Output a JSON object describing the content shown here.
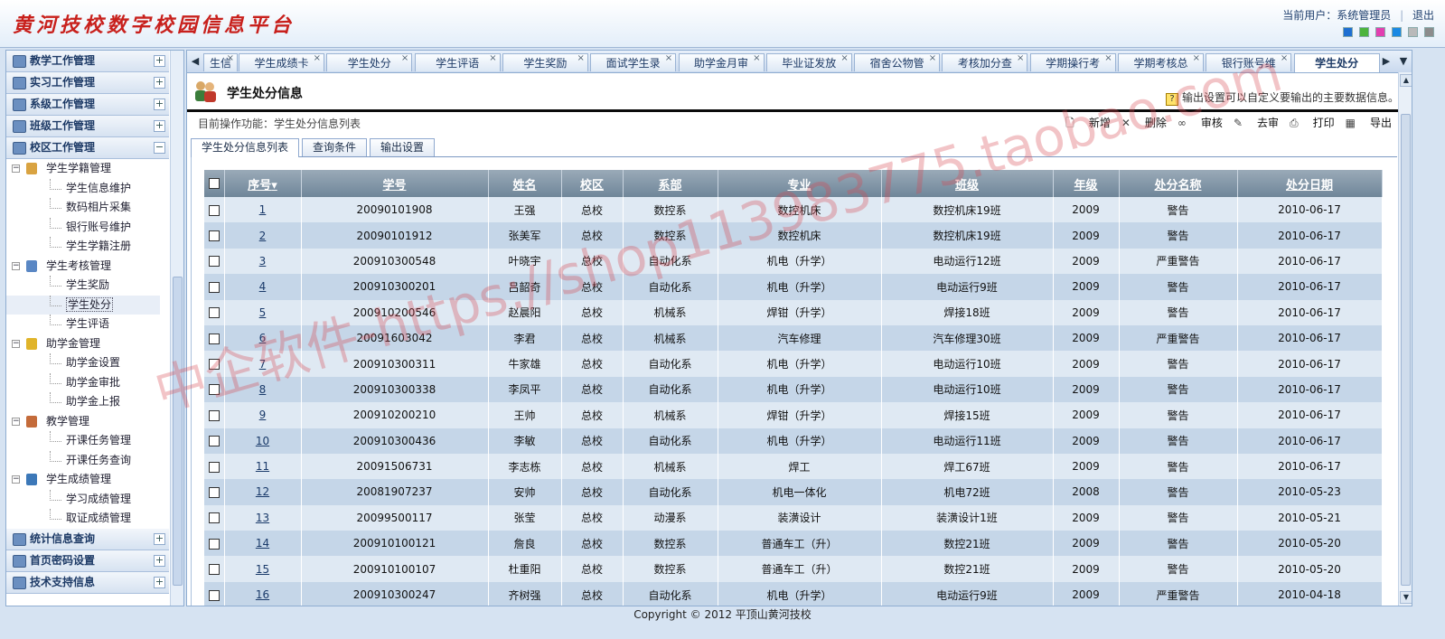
{
  "header": {
    "brand": "黄河技校数字校园信息平台",
    "current_user": "当前用户：系统管理员",
    "logout": "退出",
    "skin_colors": [
      "#1e6fd1",
      "#4cb43c",
      "#e23fb0",
      "#1a89e3",
      "#b9b9b9",
      "#8c8c8c"
    ]
  },
  "sidebar": {
    "top_groups": [
      {
        "label": "教学工作管理",
        "toggle": "+"
      },
      {
        "label": "实习工作管理",
        "toggle": "+"
      },
      {
        "label": "系级工作管理",
        "toggle": "+"
      },
      {
        "label": "班级工作管理",
        "toggle": "+"
      },
      {
        "label": "校区工作管理",
        "toggle": "−"
      }
    ],
    "tree": [
      {
        "label": "学生学籍管理",
        "toggle": "−",
        "color": "#d9a341",
        "children": [
          "学生信息维护",
          "数码相片采集",
          "银行账号维护",
          "学生学籍注册"
        ]
      },
      {
        "label": "学生考核管理",
        "toggle": "−",
        "color": "#5a87c4",
        "children": [
          "学生奖励",
          "学生处分",
          "学生评语"
        ]
      },
      {
        "label": "助学金管理",
        "toggle": "−",
        "color": "#e0b42a",
        "children": [
          "助学金设置",
          "助学金审批",
          "助学金上报"
        ]
      },
      {
        "label": "教学管理",
        "toggle": "−",
        "color": "#c46b3a",
        "children": [
          "开课任务管理",
          "开课任务查询"
        ]
      },
      {
        "label": "学生成绩管理",
        "toggle": "−",
        "color": "#3c78b8",
        "children": [
          "学习成绩管理",
          "取证成绩管理"
        ]
      }
    ],
    "bottom_groups": [
      {
        "label": "统计信息查询",
        "toggle": "+"
      },
      {
        "label": "首页密码设置",
        "toggle": "+"
      },
      {
        "label": "技术支持信息",
        "toggle": "+"
      }
    ]
  },
  "page_tabs": [
    {
      "label": "生信"
    },
    {
      "label": "学生成绩卡"
    },
    {
      "label": "学生处分"
    },
    {
      "label": "学生评语"
    },
    {
      "label": "学生奖励"
    },
    {
      "label": "面试学生录"
    },
    {
      "label": "助学金月审"
    },
    {
      "label": "毕业证发放"
    },
    {
      "label": "宿舍公物管"
    },
    {
      "label": "考核加分查"
    },
    {
      "label": "学期操行考"
    },
    {
      "label": "学期考核总"
    },
    {
      "label": "银行账号维"
    },
    {
      "label": "学生处分",
      "active": true
    }
  ],
  "title": {
    "text": "学生处分信息",
    "tip": "输出设置可以自定义要输出的主要数据信息。"
  },
  "operation": {
    "current": "目前操作功能：学生处分信息列表",
    "actions": [
      {
        "icon": "new-doc-icon",
        "glyph": "🗋",
        "label": "新增"
      },
      {
        "icon": "delete-icon",
        "glyph": "✕",
        "label": "删除"
      },
      {
        "icon": "audit-icon",
        "glyph": "∞",
        "label": "审核"
      },
      {
        "icon": "unaudit-icon",
        "glyph": "✎",
        "label": "去审"
      },
      {
        "icon": "print-icon",
        "glyph": "⎙",
        "label": "打印"
      },
      {
        "icon": "export-icon",
        "glyph": "▦",
        "label": "导出"
      }
    ]
  },
  "sub_tabs": [
    "学生处分信息列表",
    "查询条件",
    "输出设置"
  ],
  "table": {
    "columns": [
      "序号",
      "学号",
      "姓名",
      "校区",
      "系部",
      "专业",
      "班级",
      "年级",
      "处分名称",
      "处分日期"
    ],
    "sort_indicator": "▾",
    "rows": [
      [
        "1",
        "20090101908",
        "王强",
        "总校",
        "数控系",
        "数控机床",
        "数控机床19班",
        "2009",
        "警告",
        "2010-06-17"
      ],
      [
        "2",
        "20090101912",
        "张美军",
        "总校",
        "数控系",
        "数控机床",
        "数控机床19班",
        "2009",
        "警告",
        "2010-06-17"
      ],
      [
        "3",
        "200910300548",
        "叶晓宇",
        "总校",
        "自动化系",
        "机电（升学）",
        "电动运行12班",
        "2009",
        "严重警告",
        "2010-06-17"
      ],
      [
        "4",
        "200910300201",
        "吕韶奇",
        "总校",
        "自动化系",
        "机电（升学）",
        "电动运行9班",
        "2009",
        "警告",
        "2010-06-17"
      ],
      [
        "5",
        "200910200546",
        "赵晨阳",
        "总校",
        "机械系",
        "焊钳（升学）",
        "焊接18班",
        "2009",
        "警告",
        "2010-06-17"
      ],
      [
        "6",
        "20091603042",
        "李君",
        "总校",
        "机械系",
        "汽车修理",
        "汽车修理30班",
        "2009",
        "严重警告",
        "2010-06-17"
      ],
      [
        "7",
        "200910300311",
        "牛家雄",
        "总校",
        "自动化系",
        "机电（升学）",
        "电动运行10班",
        "2009",
        "警告",
        "2010-06-17"
      ],
      [
        "8",
        "200910300338",
        "李凤平",
        "总校",
        "自动化系",
        "机电（升学）",
        "电动运行10班",
        "2009",
        "警告",
        "2010-06-17"
      ],
      [
        "9",
        "200910200210",
        "王帅",
        "总校",
        "机械系",
        "焊钳（升学）",
        "焊接15班",
        "2009",
        "警告",
        "2010-06-17"
      ],
      [
        "10",
        "200910300436",
        "李敏",
        "总校",
        "自动化系",
        "机电（升学）",
        "电动运行11班",
        "2009",
        "警告",
        "2010-06-17"
      ],
      [
        "11",
        "20091506731",
        "李志栋",
        "总校",
        "机械系",
        "焊工",
        "焊工67班",
        "2009",
        "警告",
        "2010-06-17"
      ],
      [
        "12",
        "20081907237",
        "安帅",
        "总校",
        "自动化系",
        "机电一体化",
        "机电72班",
        "2008",
        "警告",
        "2010-05-23"
      ],
      [
        "13",
        "20099500117",
        "张莹",
        "总校",
        "动漫系",
        "装潢设计",
        "装潢设计1班",
        "2009",
        "警告",
        "2010-05-21"
      ],
      [
        "14",
        "200910100121",
        "詹良",
        "总校",
        "数控系",
        "普通车工（升）",
        "数控21班",
        "2009",
        "警告",
        "2010-05-20"
      ],
      [
        "15",
        "200910100107",
        "杜重阳",
        "总校",
        "数控系",
        "普通车工（升）",
        "数控21班",
        "2009",
        "警告",
        "2010-05-20"
      ],
      [
        "16",
        "200910300247",
        "齐树强",
        "总校",
        "自动化系",
        "机电（升学）",
        "电动运行9班",
        "2009",
        "严重警告",
        "2010-04-18"
      ]
    ]
  },
  "footer": "Copyright © 2012 平顶山黄河技校",
  "watermark": "中企软件-https://shop113983775.taobao.com"
}
